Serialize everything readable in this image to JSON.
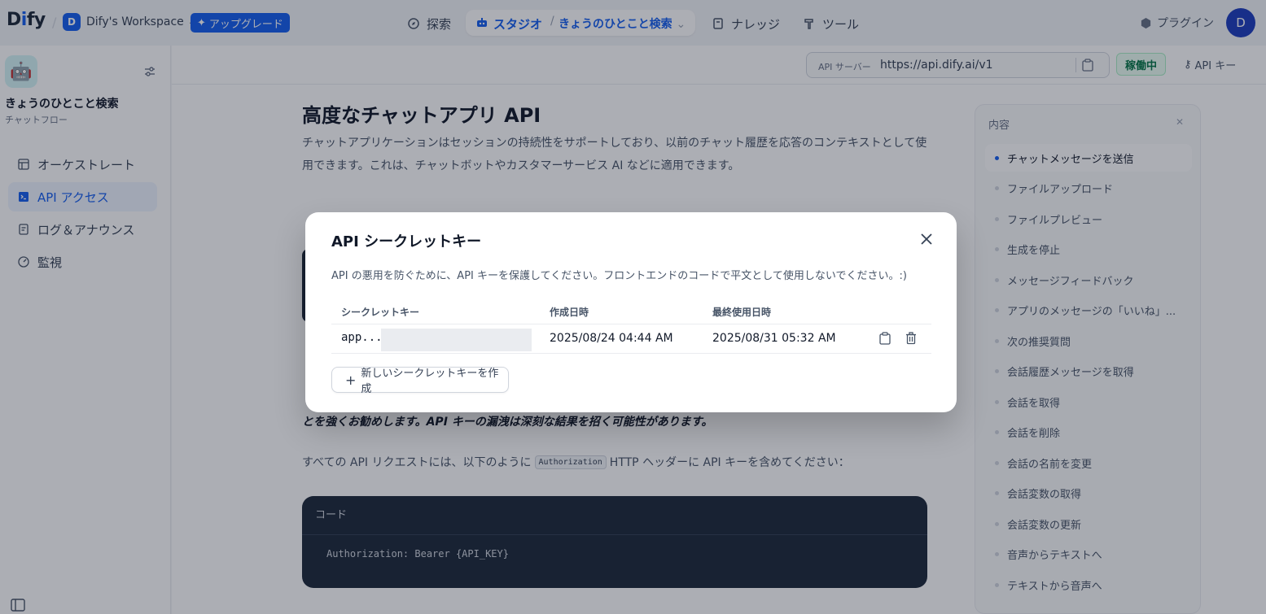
{
  "topbar": {
    "logo": "Dify",
    "workspace_initial": "D",
    "workspace_name": "Dify's Workspace",
    "upgrade_label": "アップグレード",
    "nav": {
      "explore": "探索",
      "studio": "スタジオ",
      "current_app": "きょうのひとこと検索",
      "knowledge": "ナレッジ",
      "tools": "ツール"
    },
    "plugin_label": "プラグイン",
    "user_initial": "D"
  },
  "sidebar": {
    "app_name": "きょうのひとこと検索",
    "app_type": "チャットフロー",
    "items": [
      {
        "label": "オーケストレート",
        "icon": "layout-icon"
      },
      {
        "label": "API アクセス",
        "icon": "terminal-icon"
      },
      {
        "label": "ログ＆アナウンス",
        "icon": "file-icon"
      },
      {
        "label": "監視",
        "icon": "gauge-icon"
      }
    ]
  },
  "subbar": {
    "server_label": "API サーバー",
    "server_url": "https://api.dify.ai/v1",
    "status": "稼働中",
    "api_key_label": "API キー"
  },
  "doc": {
    "title": "高度なチャットアプリ API",
    "description": "チャットアプリケーションはセッションの持続性をサポートしており、以前のチャット履歴を応答のコンテキストとして使用できます。これは、チャットボットやカスタマーサービス AI などに適用できます。",
    "warning": "とを強くお勧めします。API キーの漏洩は深刻な結果を招く可能性があります。",
    "auth_prefix": "すべての API リクエストには、以下のように",
    "auth_code": "Authorization",
    "auth_suffix": "HTTP ヘッダーに API キーを含めてください：",
    "code_header": "コード",
    "code_body": "Authorization: Bearer {API_KEY}"
  },
  "toc": {
    "head": "内容",
    "items": [
      "チャットメッセージを送信",
      "ファイルアップロード",
      "ファイルプレビュー",
      "生成を停止",
      "メッセージフィードバック",
      "アプリのメッセージの「いいね」...",
      "次の推奨質問",
      "会話履歴メッセージを取得",
      "会話を取得",
      "会話を削除",
      "会話の名前を変更",
      "会話変数の取得",
      "会話変数の更新",
      "音声からテキストへ",
      "テキストから音声へ"
    ]
  },
  "modal": {
    "title": "API シークレットキー",
    "description": "API の悪用を防ぐために、API キーを保護してください。フロントエンドのコードで平文として使用しないでください。:)",
    "columns": [
      "シークレットキー",
      "作成日時",
      "最終使用日時"
    ],
    "rows": [
      {
        "key": "app...",
        "created": "2025/08/24 04:44 AM",
        "last_used": "2025/08/31 05:32 AM"
      }
    ],
    "new_key_label": "新しいシークレットキーを作成"
  },
  "colors": {
    "accent": "#155eef",
    "status_green": "#067647"
  }
}
